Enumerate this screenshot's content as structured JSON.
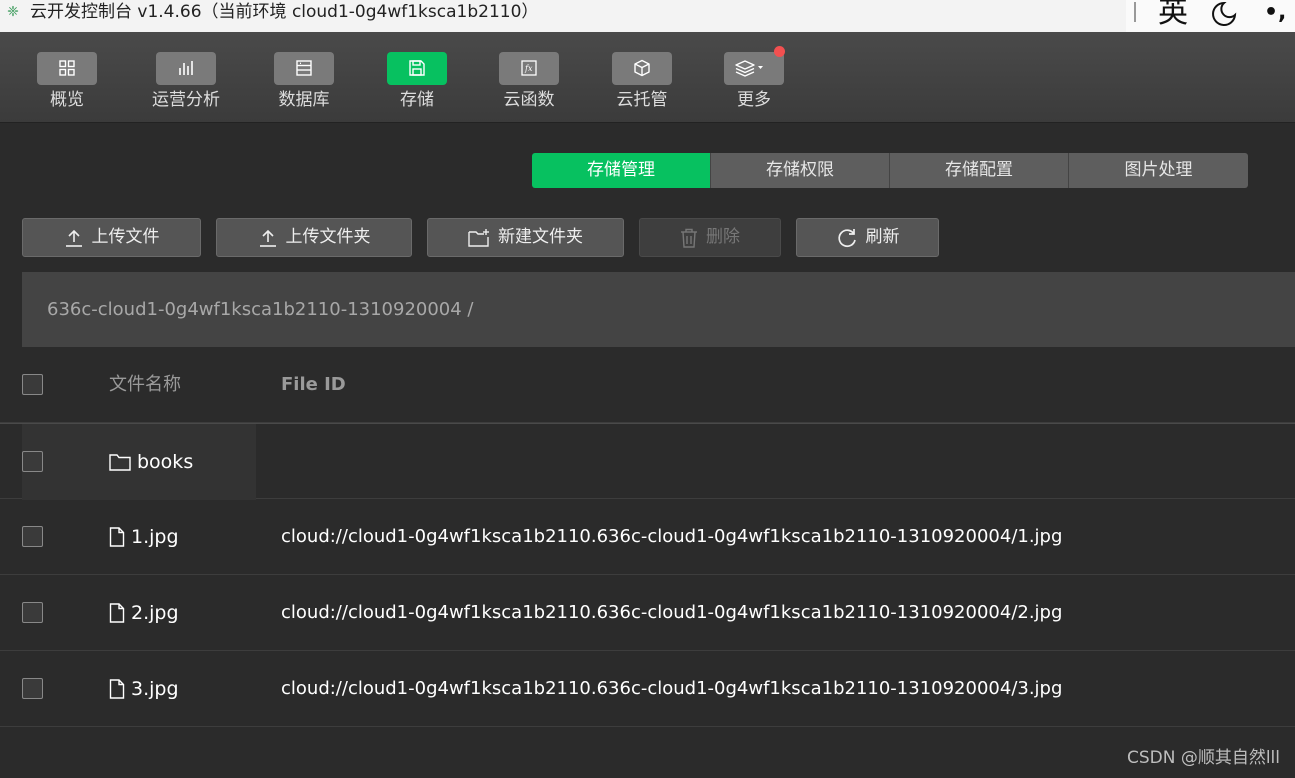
{
  "window": {
    "title": "云开发控制台 v1.4.66（当前环境 cloud1-0g4wf1ksca1b2110）"
  },
  "ime": {
    "lang": "英",
    "punct": "•,"
  },
  "toolbar": {
    "items": [
      {
        "label": "概览",
        "icon": "grid-icon"
      },
      {
        "label": "运营分析",
        "icon": "bar-chart-icon"
      },
      {
        "label": "数据库",
        "icon": "database-icon"
      },
      {
        "label": "存储",
        "icon": "save-icon",
        "active": true
      },
      {
        "label": "云函数",
        "icon": "function-icon"
      },
      {
        "label": "云托管",
        "icon": "cube-icon"
      },
      {
        "label": "更多",
        "icon": "layers-icon",
        "badge": true
      }
    ]
  },
  "tabs": [
    {
      "label": "存储管理",
      "active": true
    },
    {
      "label": "存储权限"
    },
    {
      "label": "存储配置"
    },
    {
      "label": "图片处理"
    }
  ],
  "actions": {
    "upload_file": "上传文件",
    "upload_folder": "上传文件夹",
    "new_folder": "新建文件夹",
    "delete": "删除",
    "refresh": "刷新"
  },
  "path": "636c-cloud1-0g4wf1ksca1b2110-1310920004  /",
  "table": {
    "headers": {
      "name": "文件名称",
      "file_id": "File ID"
    },
    "rows": [
      {
        "type": "folder",
        "name": "books",
        "file_id": ""
      },
      {
        "type": "file",
        "name": "1.jpg",
        "file_id": "cloud://cloud1-0g4wf1ksca1b2110.636c-cloud1-0g4wf1ksca1b2110-1310920004/1.jpg"
      },
      {
        "type": "file",
        "name": "2.jpg",
        "file_id": "cloud://cloud1-0g4wf1ksca1b2110.636c-cloud1-0g4wf1ksca1b2110-1310920004/2.jpg"
      },
      {
        "type": "file",
        "name": "3.jpg",
        "file_id": "cloud://cloud1-0g4wf1ksca1b2110.636c-cloud1-0g4wf1ksca1b2110-1310920004/3.jpg"
      }
    ]
  },
  "watermark": "CSDN @顺其自然lll",
  "colors": {
    "accent": "#07c160",
    "badge": "#f25050",
    "background": "#2b2b2b"
  }
}
